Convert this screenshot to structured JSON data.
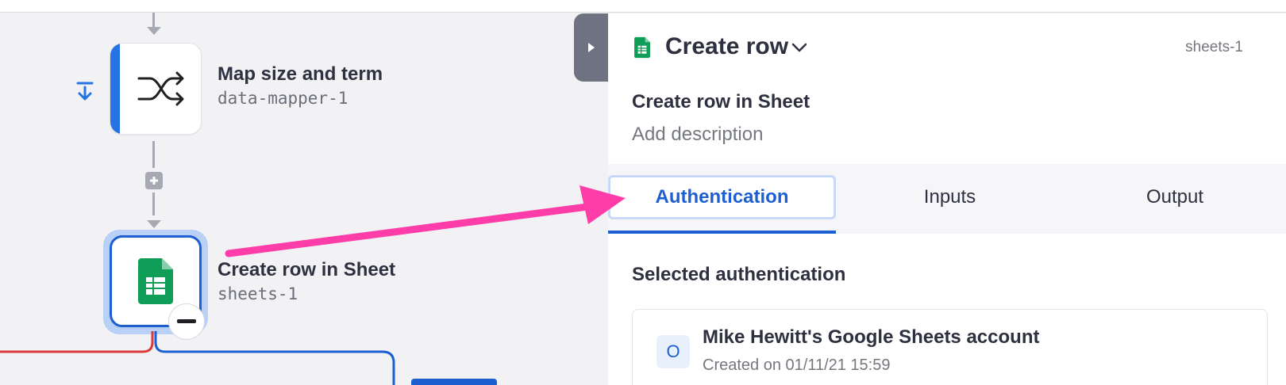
{
  "canvas": {
    "nodes": [
      {
        "title": "Map size and term",
        "key": "data-mapper-1",
        "icon": "shuffle-icon"
      },
      {
        "title": "Create row in Sheet",
        "key": "sheets-1",
        "icon": "google-sheets-icon",
        "selected": true
      }
    ],
    "add_step_icon": "plus-icon",
    "collapse_icon": "minus-icon",
    "step_marker_icon": "arrow-down-to-line-icon",
    "colors": {
      "accent": "#2673e6",
      "error_branch": "#d93a3a",
      "success_branch": "#1d5fd1",
      "annotation_arrow": "#ff3da8"
    }
  },
  "panel": {
    "header": {
      "title": "Create row",
      "key": "sheets-1",
      "icon": "google-sheets-icon",
      "dropdown_icon": "chevron-down-icon"
    },
    "step_name": "Create row in Sheet",
    "description_placeholder": "Add description",
    "tabs": [
      {
        "label": "Authentication",
        "active": true
      },
      {
        "label": "Inputs",
        "active": false
      },
      {
        "label": "Output",
        "active": false
      }
    ],
    "auth": {
      "section_title": "Selected authentication",
      "account_initial": "O",
      "account_name": "Mike Hewitt's Google Sheets account",
      "account_created": "Created on 01/11/21 15:59"
    }
  }
}
